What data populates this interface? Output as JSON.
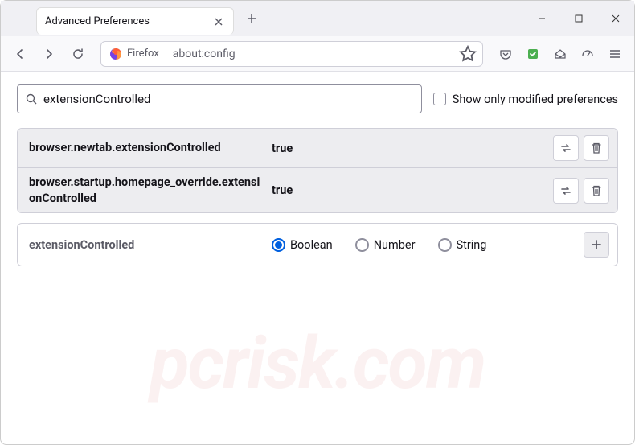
{
  "titlebar": {
    "tab_title": "Advanced Preferences"
  },
  "navbar": {
    "identity_label": "Firefox",
    "url": "about:config"
  },
  "search": {
    "value": "extensionControlled",
    "checkbox_label": "Show only modified preferences"
  },
  "prefs": [
    {
      "name": "browser.newtab.extensionControlled",
      "value": "true"
    },
    {
      "name": "browser.startup.homepage_override.extensionControlled",
      "value": "true"
    }
  ],
  "new_pref": {
    "name": "extensionControlled",
    "types": [
      "Boolean",
      "Number",
      "String"
    ],
    "selected": "Boolean"
  },
  "watermark": "pcrisk.com"
}
